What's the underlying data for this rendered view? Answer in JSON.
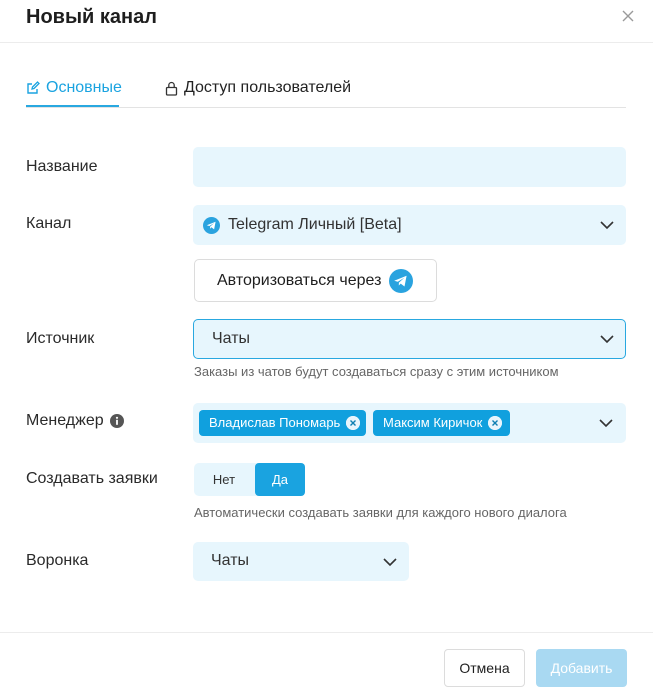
{
  "dialog": {
    "title": "Новый канал",
    "close_icon": "close-icon"
  },
  "tabs": [
    {
      "label": "Основные",
      "icon": "edit-icon",
      "active": true
    },
    {
      "label": "Доступ пользователей",
      "icon": "lock-icon",
      "active": false
    }
  ],
  "form": {
    "name": {
      "label": "Название",
      "value": ""
    },
    "channel": {
      "label": "Канал",
      "value": "Telegram Личный [Beta]",
      "icon": "telegram-icon"
    },
    "auth": {
      "label": "Авторизоваться через",
      "icon": "telegram-icon"
    },
    "source": {
      "label": "Источник",
      "value": "Чаты",
      "hint": "Заказы из чатов будут создаваться сразу с этим источником"
    },
    "manager": {
      "label": "Менеджер",
      "info_icon": "info-icon",
      "tags": [
        "Владислав Пономарь",
        "Максим Киричок"
      ]
    },
    "create_requests": {
      "label": "Создавать заявки",
      "options": [
        "Нет",
        "Да"
      ],
      "selected": "Да",
      "hint": "Автоматически создавать заявки для каждого нового диалога"
    },
    "funnel": {
      "label": "Воронка",
      "value": "Чаты"
    }
  },
  "footer": {
    "cancel_label": "Отмена",
    "add_label": "Добавить"
  },
  "colors": {
    "accent": "#1aa3e0",
    "field_bg": "#e7f6fd",
    "tag_bg": "#10a0de",
    "disabled_btn": "#a9d9f2"
  }
}
